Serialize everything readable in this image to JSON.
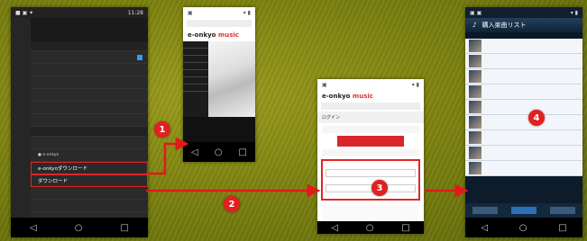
{
  "phone1": {
    "status_time": "11:28",
    "menu_items": [
      "",
      "",
      "",
      "",
      "",
      "",
      "",
      "",
      "",
      "",
      "",
      "",
      "",
      ""
    ],
    "highlight1": "e-onkyoダウンロード",
    "highlight2": "ダウンロード"
  },
  "phone2": {
    "logo_left": "e-onkyo",
    "logo_right": "music"
  },
  "phone3": {
    "logo_left": "e-onkyo",
    "logo_right": "music",
    "section": "ログイン"
  },
  "phone4": {
    "title": "購入楽曲リスト",
    "tracks": [
      "",
      "",
      "",
      "",
      "",
      "",
      "",
      "",
      "",
      "",
      ""
    ]
  },
  "badges": [
    "1",
    "2",
    "3",
    "4"
  ],
  "colors": {
    "arrow": "#e01a1a",
    "badge": "#e12020"
  }
}
